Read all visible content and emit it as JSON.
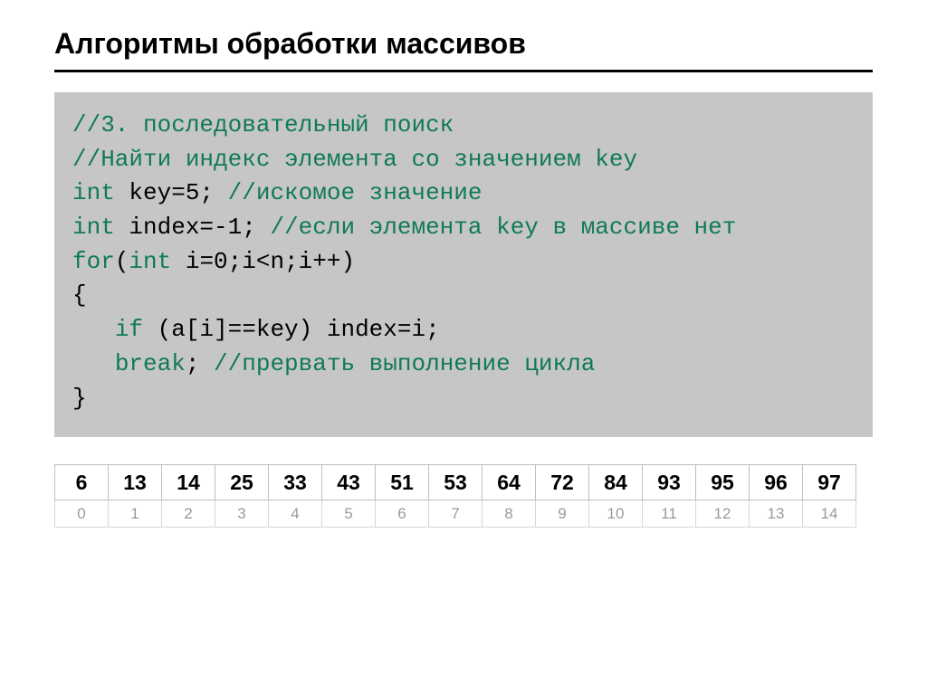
{
  "title": "Алгоритмы обработки массивов",
  "code": {
    "l1_comment": "//3. последовательный поиск",
    "l2_comment": "//Найти индекс элемента со значением key",
    "l3_a": "int",
    "l3_b": " key=5; ",
    "l3_c": "//искомое значение",
    "l4_a": "int",
    "l4_b": " index=-1; ",
    "l4_c": "//если элемента key в массиве нет",
    "l5_a": "for",
    "l5_b": "(",
    "l5_c": "int",
    "l5_d": " i=0;i<n;i++)",
    "l6": "{",
    "l7_a": "   ",
    "l7_b": "if",
    "l7_c": " (a[i]==key) index=i;",
    "l8_a": "   ",
    "l8_b": "break",
    "l8_c": "; ",
    "l8_d": "//прервать выполнение цикла",
    "l9": "}"
  },
  "array": {
    "values": [
      "6",
      "13",
      "14",
      "25",
      "33",
      "43",
      "51",
      "53",
      "64",
      "72",
      "84",
      "93",
      "95",
      "96",
      "97"
    ],
    "indices": [
      "0",
      "1",
      "2",
      "3",
      "4",
      "5",
      "6",
      "7",
      "8",
      "9",
      "10",
      "11",
      "12",
      "13",
      "14"
    ]
  },
  "chart_data": {
    "type": "table",
    "title": "Array values with indices",
    "categories": [
      0,
      1,
      2,
      3,
      4,
      5,
      6,
      7,
      8,
      9,
      10,
      11,
      12,
      13,
      14
    ],
    "values": [
      6,
      13,
      14,
      25,
      33,
      43,
      51,
      53,
      64,
      72,
      84,
      93,
      95,
      96,
      97
    ]
  }
}
